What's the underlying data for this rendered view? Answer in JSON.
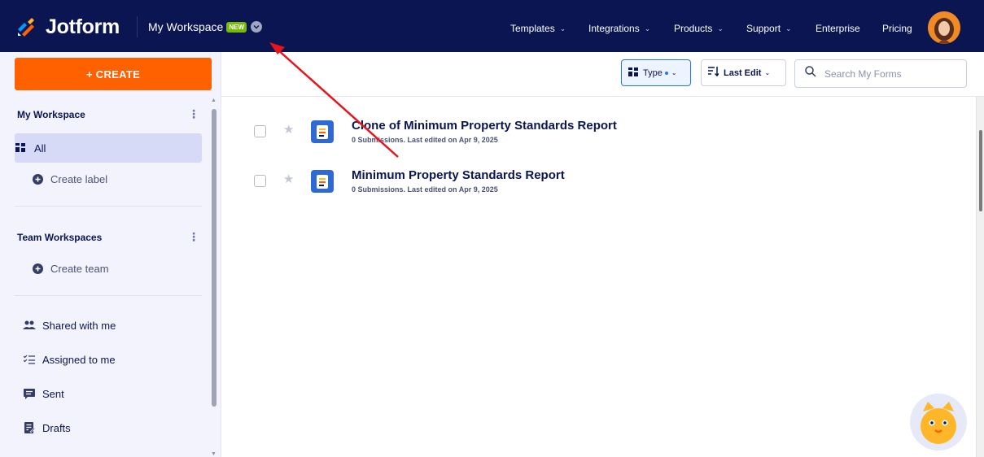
{
  "topbar": {
    "brand": "Jotform",
    "workspace_title": "My Workspace",
    "workspace_badge": "NEW",
    "nav": [
      {
        "label": "Templates",
        "has_dropdown": true
      },
      {
        "label": "Integrations",
        "has_dropdown": true
      },
      {
        "label": "Products",
        "has_dropdown": true
      },
      {
        "label": "Support",
        "has_dropdown": true
      },
      {
        "label": "Enterprise",
        "has_dropdown": false
      },
      {
        "label": "Pricing",
        "has_dropdown": false
      }
    ],
    "colors": {
      "bar": "#0a1551",
      "badge": "#78bb07"
    }
  },
  "toolbar": {
    "type_label": "Type",
    "sort_label": "Last Edit",
    "search_placeholder": "Search My Forms"
  },
  "sidebar": {
    "create_label": "+ CREATE",
    "my_workspace_heading": "My Workspace",
    "all_label": "All",
    "create_label_link": "Create label",
    "team_heading": "Team Workspaces",
    "create_team_link": "Create team",
    "items": [
      {
        "label": "Shared with me",
        "icon": "people-icon"
      },
      {
        "label": "Assigned to me",
        "icon": "list-check-icon"
      },
      {
        "label": "Sent",
        "icon": "message-icon"
      },
      {
        "label": "Drafts",
        "icon": "draft-icon"
      }
    ],
    "colors": {
      "create_button": "#ff6100",
      "selected": "#d6daf7"
    }
  },
  "forms": [
    {
      "title": "Clone of Minimum Property Standards Report",
      "meta": "0 Submissions. Last edited on Apr 9, 2025"
    },
    {
      "title": "Minimum Property Standards Report",
      "meta": "0 Submissions. Last edited on Apr 9, 2025"
    }
  ],
  "annotation": {
    "type": "red arrow",
    "color": "#e8141c",
    "points_to": "workspace-switcher"
  }
}
